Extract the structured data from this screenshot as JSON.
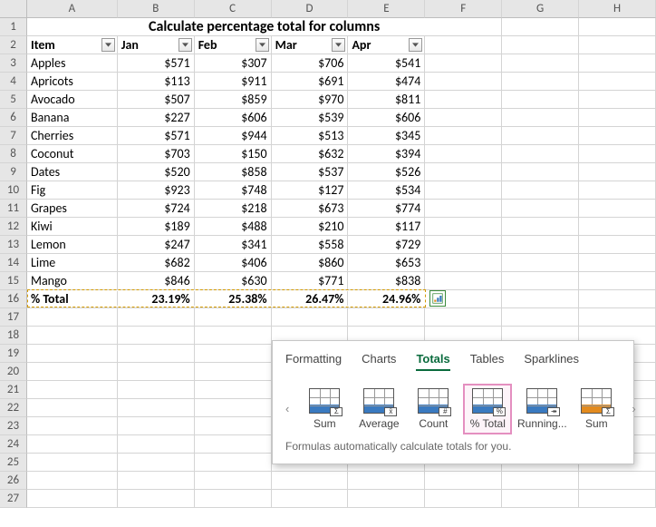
{
  "columns": [
    "A",
    "B",
    "C",
    "D",
    "E",
    "F",
    "G",
    "H"
  ],
  "colWidths": {
    "A": 100,
    "B": 85,
    "C": 85,
    "D": 85,
    "E": 85,
    "F": 85,
    "G": 85,
    "H": 85
  },
  "title": "Calculate percentage total for columns",
  "headers": {
    "item": "Item",
    "jan": "Jan",
    "feb": "Feb",
    "mar": "Mar",
    "apr": "Apr"
  },
  "rows": [
    {
      "n": 3,
      "item": "Apples",
      "jan": "$571",
      "feb": "$307",
      "mar": "$706",
      "apr": "$541"
    },
    {
      "n": 4,
      "item": "Apricots",
      "jan": "$113",
      "feb": "$911",
      "mar": "$691",
      "apr": "$474"
    },
    {
      "n": 5,
      "item": "Avocado",
      "jan": "$507",
      "feb": "$859",
      "mar": "$970",
      "apr": "$811"
    },
    {
      "n": 6,
      "item": "Banana",
      "jan": "$227",
      "feb": "$606",
      "mar": "$539",
      "apr": "$606"
    },
    {
      "n": 7,
      "item": "Cherries",
      "jan": "$571",
      "feb": "$944",
      "mar": "$513",
      "apr": "$345"
    },
    {
      "n": 8,
      "item": "Coconut",
      "jan": "$703",
      "feb": "$150",
      "mar": "$632",
      "apr": "$394"
    },
    {
      "n": 9,
      "item": "Dates",
      "jan": "$520",
      "feb": "$858",
      "mar": "$537",
      "apr": "$526"
    },
    {
      "n": 10,
      "item": "Fig",
      "jan": "$923",
      "feb": "$748",
      "mar": "$127",
      "apr": "$534"
    },
    {
      "n": 11,
      "item": "Grapes",
      "jan": "$724",
      "feb": "$218",
      "mar": "$673",
      "apr": "$774"
    },
    {
      "n": 12,
      "item": "Kiwi",
      "jan": "$189",
      "feb": "$488",
      "mar": "$210",
      "apr": "$117"
    },
    {
      "n": 13,
      "item": "Lemon",
      "jan": "$247",
      "feb": "$341",
      "mar": "$558",
      "apr": "$729"
    },
    {
      "n": 14,
      "item": "Lime",
      "jan": "$682",
      "feb": "$406",
      "mar": "$860",
      "apr": "$653"
    },
    {
      "n": 15,
      "item": "Mango",
      "jan": "$846",
      "feb": "$630",
      "mar": "$771",
      "apr": "$838"
    }
  ],
  "totalRow": {
    "n": 16,
    "label": "% Total",
    "jan": "23.19%",
    "feb": "25.38%",
    "mar": "26.47%",
    "apr": "24.96%"
  },
  "emptyRows": [
    17,
    18,
    19,
    20,
    21,
    22,
    23,
    24,
    25,
    26,
    27
  ],
  "qa": {
    "tabs": [
      "Formatting",
      "Charts",
      "Totals",
      "Tables",
      "Sparklines"
    ],
    "activeTab": "Totals",
    "items": [
      {
        "label": "Sum",
        "badge": "Σ",
        "accent": "blue"
      },
      {
        "label": "Average",
        "badge": "x̄",
        "accent": "blue"
      },
      {
        "label": "Count",
        "badge": "#",
        "accent": "blue"
      },
      {
        "label": "% Total",
        "badge": "%",
        "accent": "blue",
        "selected": true
      },
      {
        "label": "Running...",
        "badge": "↠",
        "accent": "blue"
      },
      {
        "label": "Sum",
        "badge": "Σ",
        "accent": "orange"
      }
    ],
    "hint": "Formulas automatically calculate totals for you."
  },
  "chart_data": {
    "type": "table",
    "title": "Calculate percentage total for columns",
    "columns": [
      "Item",
      "Jan",
      "Feb",
      "Mar",
      "Apr"
    ],
    "data": [
      [
        "Apples",
        571,
        307,
        706,
        541
      ],
      [
        "Apricots",
        113,
        911,
        691,
        474
      ],
      [
        "Avocado",
        507,
        859,
        970,
        811
      ],
      [
        "Banana",
        227,
        606,
        539,
        606
      ],
      [
        "Cherries",
        571,
        944,
        513,
        345
      ],
      [
        "Coconut",
        703,
        150,
        632,
        394
      ],
      [
        "Dates",
        520,
        858,
        537,
        526
      ],
      [
        "Fig",
        923,
        748,
        127,
        534
      ],
      [
        "Grapes",
        724,
        218,
        673,
        774
      ],
      [
        "Kiwi",
        189,
        488,
        210,
        117
      ],
      [
        "Lemon",
        247,
        341,
        558,
        729
      ],
      [
        "Lime",
        682,
        406,
        860,
        653
      ],
      [
        "Mango",
        846,
        630,
        771,
        838
      ]
    ],
    "totals_percent": {
      "Jan": 23.19,
      "Feb": 25.38,
      "Mar": 26.47,
      "Apr": 24.96
    }
  }
}
